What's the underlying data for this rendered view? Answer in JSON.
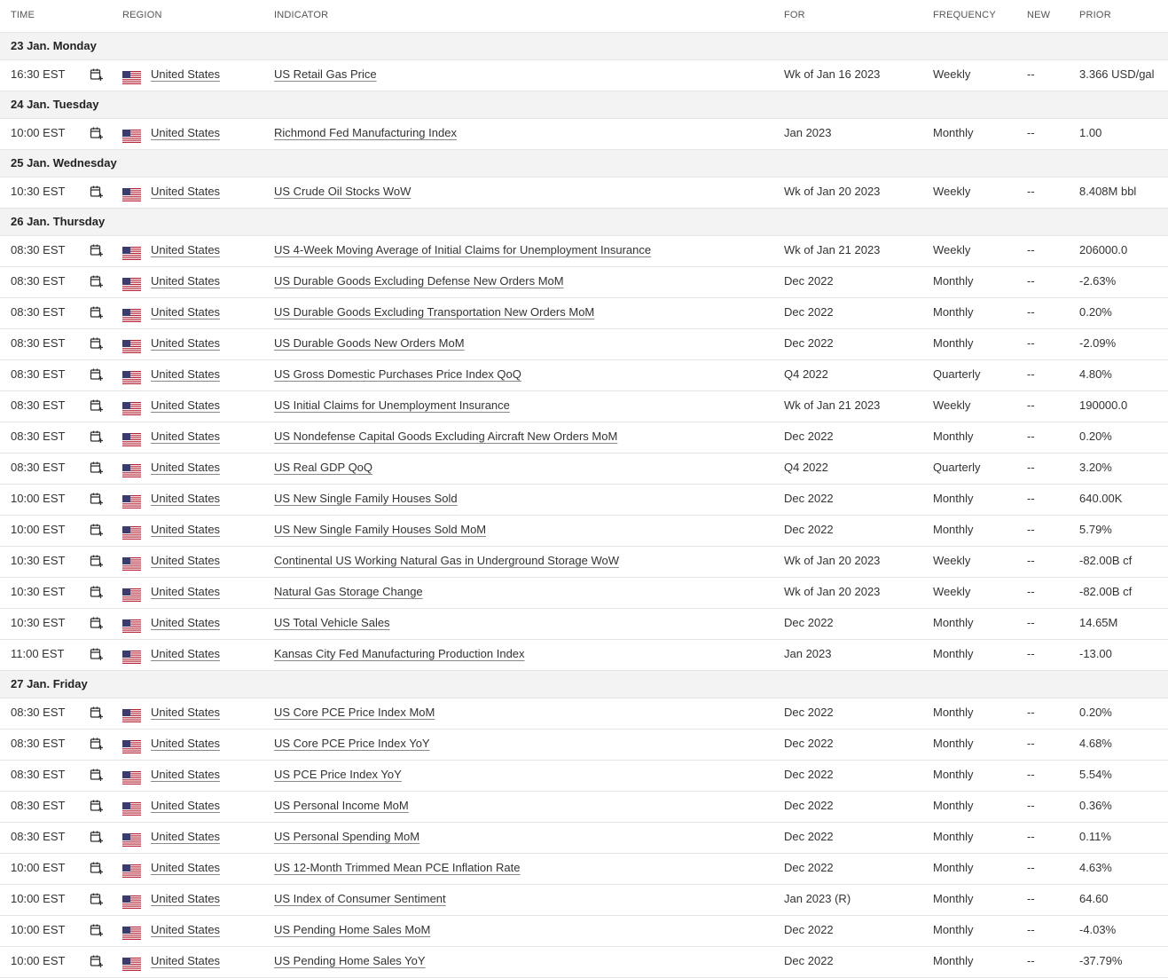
{
  "headers": {
    "time": "TIME",
    "region": "REGION",
    "indicator": "INDICATOR",
    "for": "FOR",
    "frequency": "FREQUENCY",
    "new": "NEW",
    "prior": "PRIOR"
  },
  "icons": {
    "calendar": "calendar-add-icon",
    "flag": "us-flag-icon"
  },
  "groups": [
    {
      "day": "23 Jan. Monday",
      "rows": [
        {
          "time": "16:30 EST",
          "region": "United States",
          "indicator": "US Retail Gas Price",
          "for": "Wk of Jan 16 2023",
          "frequency": "Weekly",
          "new": "--",
          "prior": "3.366 USD/gal"
        }
      ]
    },
    {
      "day": "24 Jan. Tuesday",
      "rows": [
        {
          "time": "10:00 EST",
          "region": "United States",
          "indicator": "Richmond Fed Manufacturing Index",
          "for": "Jan 2023",
          "frequency": "Monthly",
          "new": "--",
          "prior": "1.00"
        }
      ]
    },
    {
      "day": "25 Jan. Wednesday",
      "rows": [
        {
          "time": "10:30 EST",
          "region": "United States",
          "indicator": "US Crude Oil Stocks WoW",
          "for": "Wk of Jan 20 2023",
          "frequency": "Weekly",
          "new": "--",
          "prior": "8.408M bbl"
        }
      ]
    },
    {
      "day": "26 Jan. Thursday",
      "rows": [
        {
          "time": "08:30 EST",
          "region": "United States",
          "indicator": "US 4-Week Moving Average of Initial Claims for Unemployment Insurance",
          "for": "Wk of Jan 21 2023",
          "frequency": "Weekly",
          "new": "--",
          "prior": "206000.0"
        },
        {
          "time": "08:30 EST",
          "region": "United States",
          "indicator": "US Durable Goods Excluding Defense New Orders MoM",
          "for": "Dec 2022",
          "frequency": "Monthly",
          "new": "--",
          "prior": "-2.63%"
        },
        {
          "time": "08:30 EST",
          "region": "United States",
          "indicator": "US Durable Goods Excluding Transportation New Orders MoM",
          "for": "Dec 2022",
          "frequency": "Monthly",
          "new": "--",
          "prior": "0.20%"
        },
        {
          "time": "08:30 EST",
          "region": "United States",
          "indicator": "US Durable Goods New Orders MoM",
          "for": "Dec 2022",
          "frequency": "Monthly",
          "new": "--",
          "prior": "-2.09%"
        },
        {
          "time": "08:30 EST",
          "region": "United States",
          "indicator": "US Gross Domestic Purchases Price Index QoQ",
          "for": "Q4 2022",
          "frequency": "Quarterly",
          "new": "--",
          "prior": "4.80%"
        },
        {
          "time": "08:30 EST",
          "region": "United States",
          "indicator": "US Initial Claims for Unemployment Insurance",
          "for": "Wk of Jan 21 2023",
          "frequency": "Weekly",
          "new": "--",
          "prior": "190000.0"
        },
        {
          "time": "08:30 EST",
          "region": "United States",
          "indicator": "US Nondefense Capital Goods Excluding Aircraft New Orders MoM",
          "for": "Dec 2022",
          "frequency": "Monthly",
          "new": "--",
          "prior": "0.20%"
        },
        {
          "time": "08:30 EST",
          "region": "United States",
          "indicator": "US Real GDP QoQ",
          "for": "Q4 2022",
          "frequency": "Quarterly",
          "new": "--",
          "prior": "3.20%"
        },
        {
          "time": "10:00 EST",
          "region": "United States",
          "indicator": "US New Single Family Houses Sold",
          "for": "Dec 2022",
          "frequency": "Monthly",
          "new": "--",
          "prior": "640.00K"
        },
        {
          "time": "10:00 EST",
          "region": "United States",
          "indicator": "US New Single Family Houses Sold MoM",
          "for": "Dec 2022",
          "frequency": "Monthly",
          "new": "--",
          "prior": "5.79%"
        },
        {
          "time": "10:30 EST",
          "region": "United States",
          "indicator": "Continental US Working Natural Gas in Underground Storage WoW",
          "for": "Wk of Jan 20 2023",
          "frequency": "Weekly",
          "new": "--",
          "prior": "-82.00B cf"
        },
        {
          "time": "10:30 EST",
          "region": "United States",
          "indicator": "Natural Gas Storage Change",
          "for": "Wk of Jan 20 2023",
          "frequency": "Weekly",
          "new": "--",
          "prior": "-82.00B cf"
        },
        {
          "time": "10:30 EST",
          "region": "United States",
          "indicator": "US Total Vehicle Sales",
          "for": "Dec 2022",
          "frequency": "Monthly",
          "new": "--",
          "prior": "14.65M"
        },
        {
          "time": "11:00 EST",
          "region": "United States",
          "indicator": "Kansas City Fed Manufacturing Production Index",
          "for": "Jan 2023",
          "frequency": "Monthly",
          "new": "--",
          "prior": "-13.00"
        }
      ]
    },
    {
      "day": "27 Jan. Friday",
      "rows": [
        {
          "time": "08:30 EST",
          "region": "United States",
          "indicator": "US Core PCE Price Index MoM",
          "for": "Dec 2022",
          "frequency": "Monthly",
          "new": "--",
          "prior": "0.20%"
        },
        {
          "time": "08:30 EST",
          "region": "United States",
          "indicator": "US Core PCE Price Index YoY",
          "for": "Dec 2022",
          "frequency": "Monthly",
          "new": "--",
          "prior": "4.68%"
        },
        {
          "time": "08:30 EST",
          "region": "United States",
          "indicator": "US PCE Price Index YoY",
          "for": "Dec 2022",
          "frequency": "Monthly",
          "new": "--",
          "prior": "5.54%"
        },
        {
          "time": "08:30 EST",
          "region": "United States",
          "indicator": "US Personal Income MoM",
          "for": "Dec 2022",
          "frequency": "Monthly",
          "new": "--",
          "prior": "0.36%"
        },
        {
          "time": "08:30 EST",
          "region": "United States",
          "indicator": "US Personal Spending MoM",
          "for": "Dec 2022",
          "frequency": "Monthly",
          "new": "--",
          "prior": "0.11%"
        },
        {
          "time": "10:00 EST",
          "region": "United States",
          "indicator": "US 12-Month Trimmed Mean PCE Inflation Rate",
          "for": "Dec 2022",
          "frequency": "Monthly",
          "new": "--",
          "prior": "4.63%"
        },
        {
          "time": "10:00 EST",
          "region": "United States",
          "indicator": "US Index of Consumer Sentiment",
          "for": "Jan 2023 (R)",
          "frequency": "Monthly",
          "new": "--",
          "prior": "64.60"
        },
        {
          "time": "10:00 EST",
          "region": "United States",
          "indicator": "US Pending Home Sales MoM",
          "for": "Dec 2022",
          "frequency": "Monthly",
          "new": "--",
          "prior": "-4.03%"
        },
        {
          "time": "10:00 EST",
          "region": "United States",
          "indicator": "US Pending Home Sales YoY",
          "for": "Dec 2022",
          "frequency": "Monthly",
          "new": "--",
          "prior": "-37.79%"
        }
      ]
    }
  ]
}
